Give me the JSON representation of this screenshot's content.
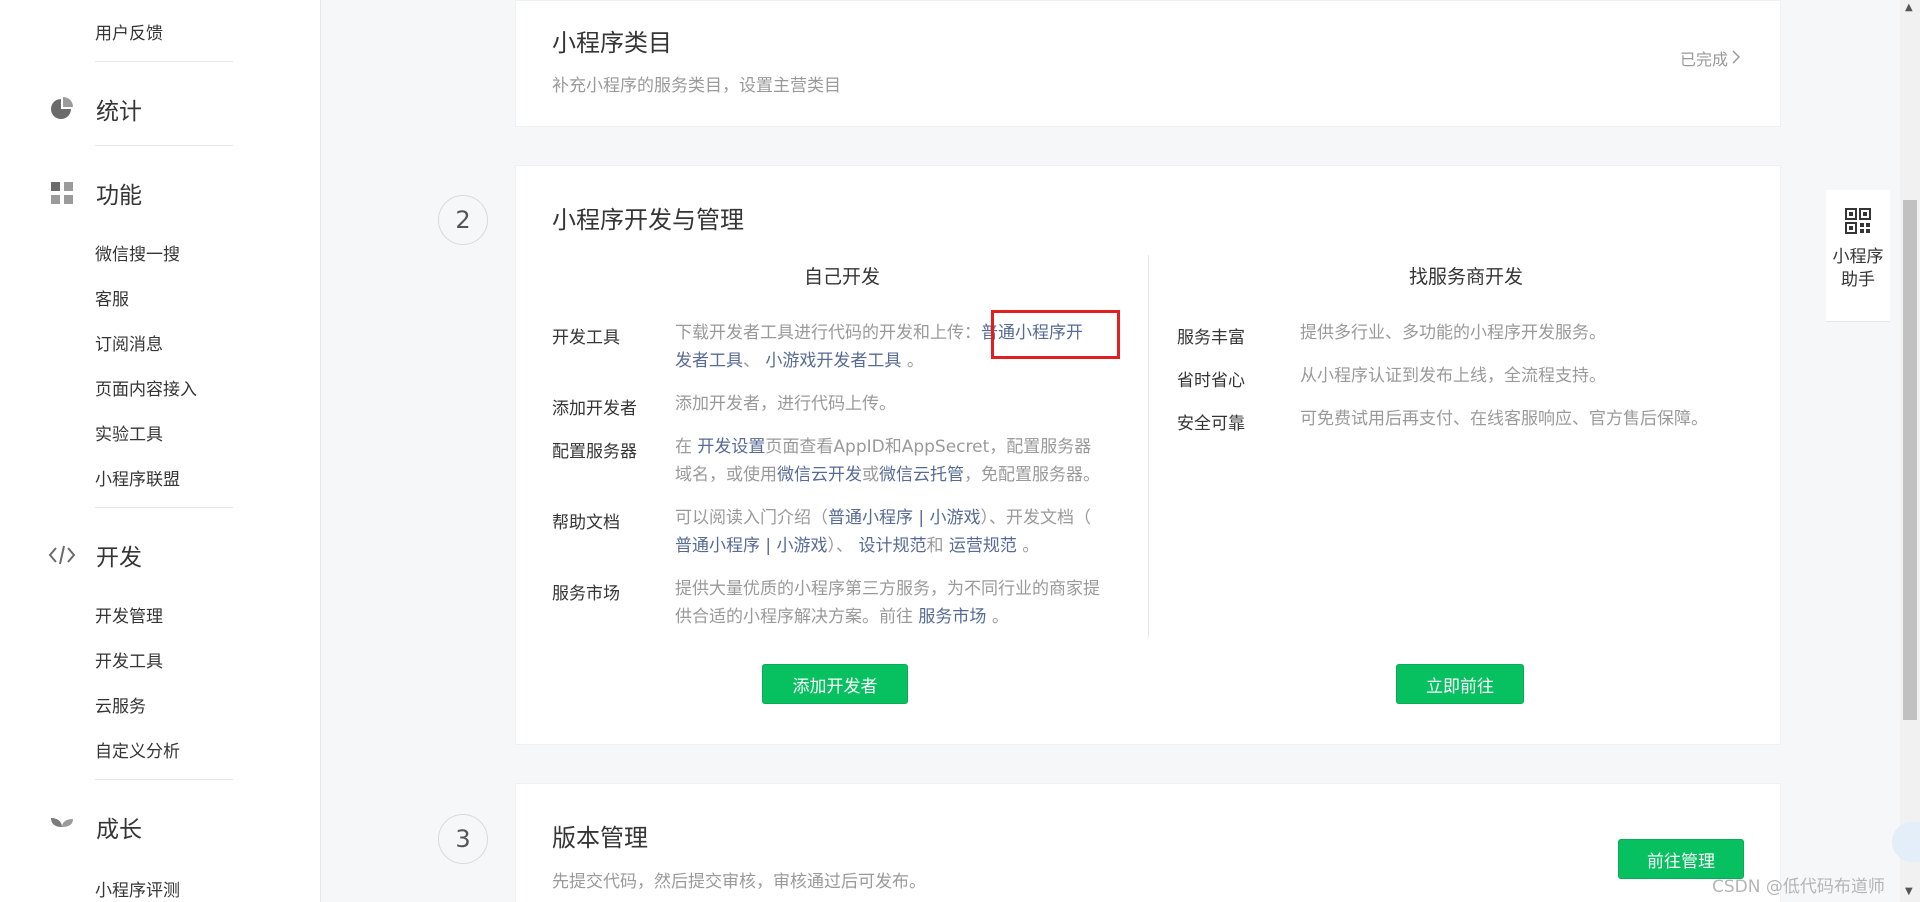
{
  "sidebar": {
    "items": [
      {
        "type": "sub",
        "label": "用户反馈"
      },
      {
        "type": "head",
        "label": "统计",
        "icon": "pie-chart-icon"
      },
      {
        "type": "head",
        "label": "功能",
        "icon": "grid-icon"
      },
      {
        "type": "sub",
        "label": "微信搜一搜"
      },
      {
        "type": "sub",
        "label": "客服"
      },
      {
        "type": "sub",
        "label": "订阅消息"
      },
      {
        "type": "sub",
        "label": "页面内容接入"
      },
      {
        "type": "sub",
        "label": "实验工具"
      },
      {
        "type": "sub",
        "label": "小程序联盟"
      },
      {
        "type": "head",
        "label": "开发",
        "icon": "code-icon"
      },
      {
        "type": "sub",
        "label": "开发管理"
      },
      {
        "type": "sub",
        "label": "开发工具"
      },
      {
        "type": "sub",
        "label": "云服务"
      },
      {
        "type": "sub",
        "label": "自定义分析"
      },
      {
        "type": "head",
        "label": "成长",
        "icon": "sprout-icon"
      },
      {
        "type": "sub",
        "label": "小程序评测"
      }
    ]
  },
  "card_category": {
    "title": "小程序类目",
    "desc": "补充小程序的服务类目，设置主营类目",
    "status": "已完成"
  },
  "card_dev": {
    "step": "2",
    "title": "小程序开发与管理",
    "self": {
      "title": "自己开发",
      "rows": {
        "tools": {
          "label": "开发工具",
          "text1": "下载开发者工具进行代码的开发和上传：",
          "link1a": "普通小程序开",
          "link1b": "发者工具",
          "sep": "、",
          "link2": "小游戏开发者工具",
          "end": "。"
        },
        "add_dev": {
          "label": "添加开发者",
          "text": "添加开发者，进行代码上传。"
        },
        "server": {
          "label": "配置服务器",
          "t1": "在",
          "l1": "开发设置",
          "t2": "页面查看AppID和AppSecret，配置服务器",
          "t3": "域名，或使用",
          "l2": "微信云开发",
          "t4": "或",
          "l3": "微信云托管",
          "t5": "，免配置服务器。"
        },
        "docs": {
          "label": "帮助文档",
          "t1": "可以阅读入门介绍（",
          "l1": "普通小程序 | 小游戏",
          "t2": "）、开发文档（",
          "l2": "普通小程序 | 小游戏",
          "t3": "）、",
          "l3": "设计规范",
          "t4": "和",
          "l4": "运营规范",
          "t5": "。"
        },
        "market": {
          "label": "服务市场",
          "t1": "提供大量优质的小程序第三方服务，为不同行业的商家提",
          "t2": "供合适的小程序解决方案。前往",
          "l1": "服务市场",
          "t3": "。"
        }
      },
      "button": "添加开发者"
    },
    "vendor": {
      "title": "找服务商开发",
      "rows": [
        {
          "label": "服务丰富",
          "text": "提供多行业、多功能的小程序开发服务。"
        },
        {
          "label": "省时省心",
          "text": "从小程序认证到发布上线，全流程支持。"
        },
        {
          "label": "安全可靠",
          "text": "可免费试用后再支付、在线客服响应、官方售后保障。"
        }
      ],
      "button": "立即前往"
    }
  },
  "card_version": {
    "step": "3",
    "title": "版本管理",
    "desc": "先提交代码，然后提交审核，审核通过后可发布。",
    "button": "前往管理"
  },
  "helper": {
    "line1": "小程序",
    "line2": "助手",
    "icon": "qr-code-icon"
  },
  "watermark": "CSDN @低代码布道师"
}
